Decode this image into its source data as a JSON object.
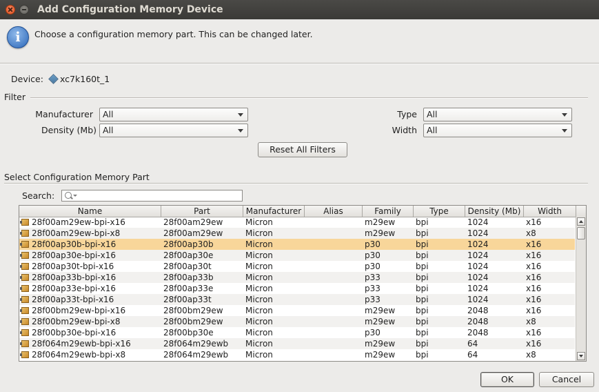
{
  "window": {
    "title": "Add Configuration Memory Device"
  },
  "info": {
    "message": "Choose a configuration memory part. This can be changed later."
  },
  "device": {
    "label": "Device:",
    "value": "xc7k160t_1"
  },
  "filter": {
    "section_title": "Filter",
    "manufacturer": {
      "label": "Manufacturer",
      "value": "All"
    },
    "density": {
      "label": "Density (Mb)",
      "value": "All"
    },
    "type": {
      "label": "Type",
      "value": "All"
    },
    "width": {
      "label": "Width",
      "value": "All"
    },
    "reset_label": "Reset All Filters"
  },
  "part_select": {
    "section_title": "Select Configuration Memory Part",
    "search_label": "Search:",
    "search_value": ""
  },
  "table": {
    "columns": [
      "Name",
      "Part",
      "Manufacturer",
      "Alias",
      "Family",
      "Type",
      "Density (Mb)",
      "Width"
    ],
    "selected_index": 2,
    "rows": [
      [
        "28f00am29ew-bpi-x16",
        "28f00am29ew",
        "Micron",
        "",
        "m29ew",
        "bpi",
        "1024",
        "x16"
      ],
      [
        "28f00am29ew-bpi-x8",
        "28f00am29ew",
        "Micron",
        "",
        "m29ew",
        "bpi",
        "1024",
        "x8"
      ],
      [
        "28f00ap30b-bpi-x16",
        "28f00ap30b",
        "Micron",
        "",
        "p30",
        "bpi",
        "1024",
        "x16"
      ],
      [
        "28f00ap30e-bpi-x16",
        "28f00ap30e",
        "Micron",
        "",
        "p30",
        "bpi",
        "1024",
        "x16"
      ],
      [
        "28f00ap30t-bpi-x16",
        "28f00ap30t",
        "Micron",
        "",
        "p30",
        "bpi",
        "1024",
        "x16"
      ],
      [
        "28f00ap33b-bpi-x16",
        "28f00ap33b",
        "Micron",
        "",
        "p33",
        "bpi",
        "1024",
        "x16"
      ],
      [
        "28f00ap33e-bpi-x16",
        "28f00ap33e",
        "Micron",
        "",
        "p33",
        "bpi",
        "1024",
        "x16"
      ],
      [
        "28f00ap33t-bpi-x16",
        "28f00ap33t",
        "Micron",
        "",
        "p33",
        "bpi",
        "1024",
        "x16"
      ],
      [
        "28f00bm29ew-bpi-x16",
        "28f00bm29ew",
        "Micron",
        "",
        "m29ew",
        "bpi",
        "2048",
        "x16"
      ],
      [
        "28f00bm29ew-bpi-x8",
        "28f00bm29ew",
        "Micron",
        "",
        "m29ew",
        "bpi",
        "2048",
        "x8"
      ],
      [
        "28f00bp30e-bpi-x16",
        "28f00bp30e",
        "Micron",
        "",
        "p30",
        "bpi",
        "2048",
        "x16"
      ],
      [
        "28f064m29ewb-bpi-x16",
        "28f064m29ewb",
        "Micron",
        "",
        "m29ew",
        "bpi",
        "64",
        "x16"
      ],
      [
        "28f064m29ewb-bpi-x8",
        "28f064m29ewb",
        "Micron",
        "",
        "m29ew",
        "bpi",
        "64",
        "x8"
      ]
    ]
  },
  "buttons": {
    "ok": "OK",
    "cancel": "Cancel"
  },
  "colors": {
    "selection": "#f8d69a",
    "titlebar": "#3c3b37"
  }
}
